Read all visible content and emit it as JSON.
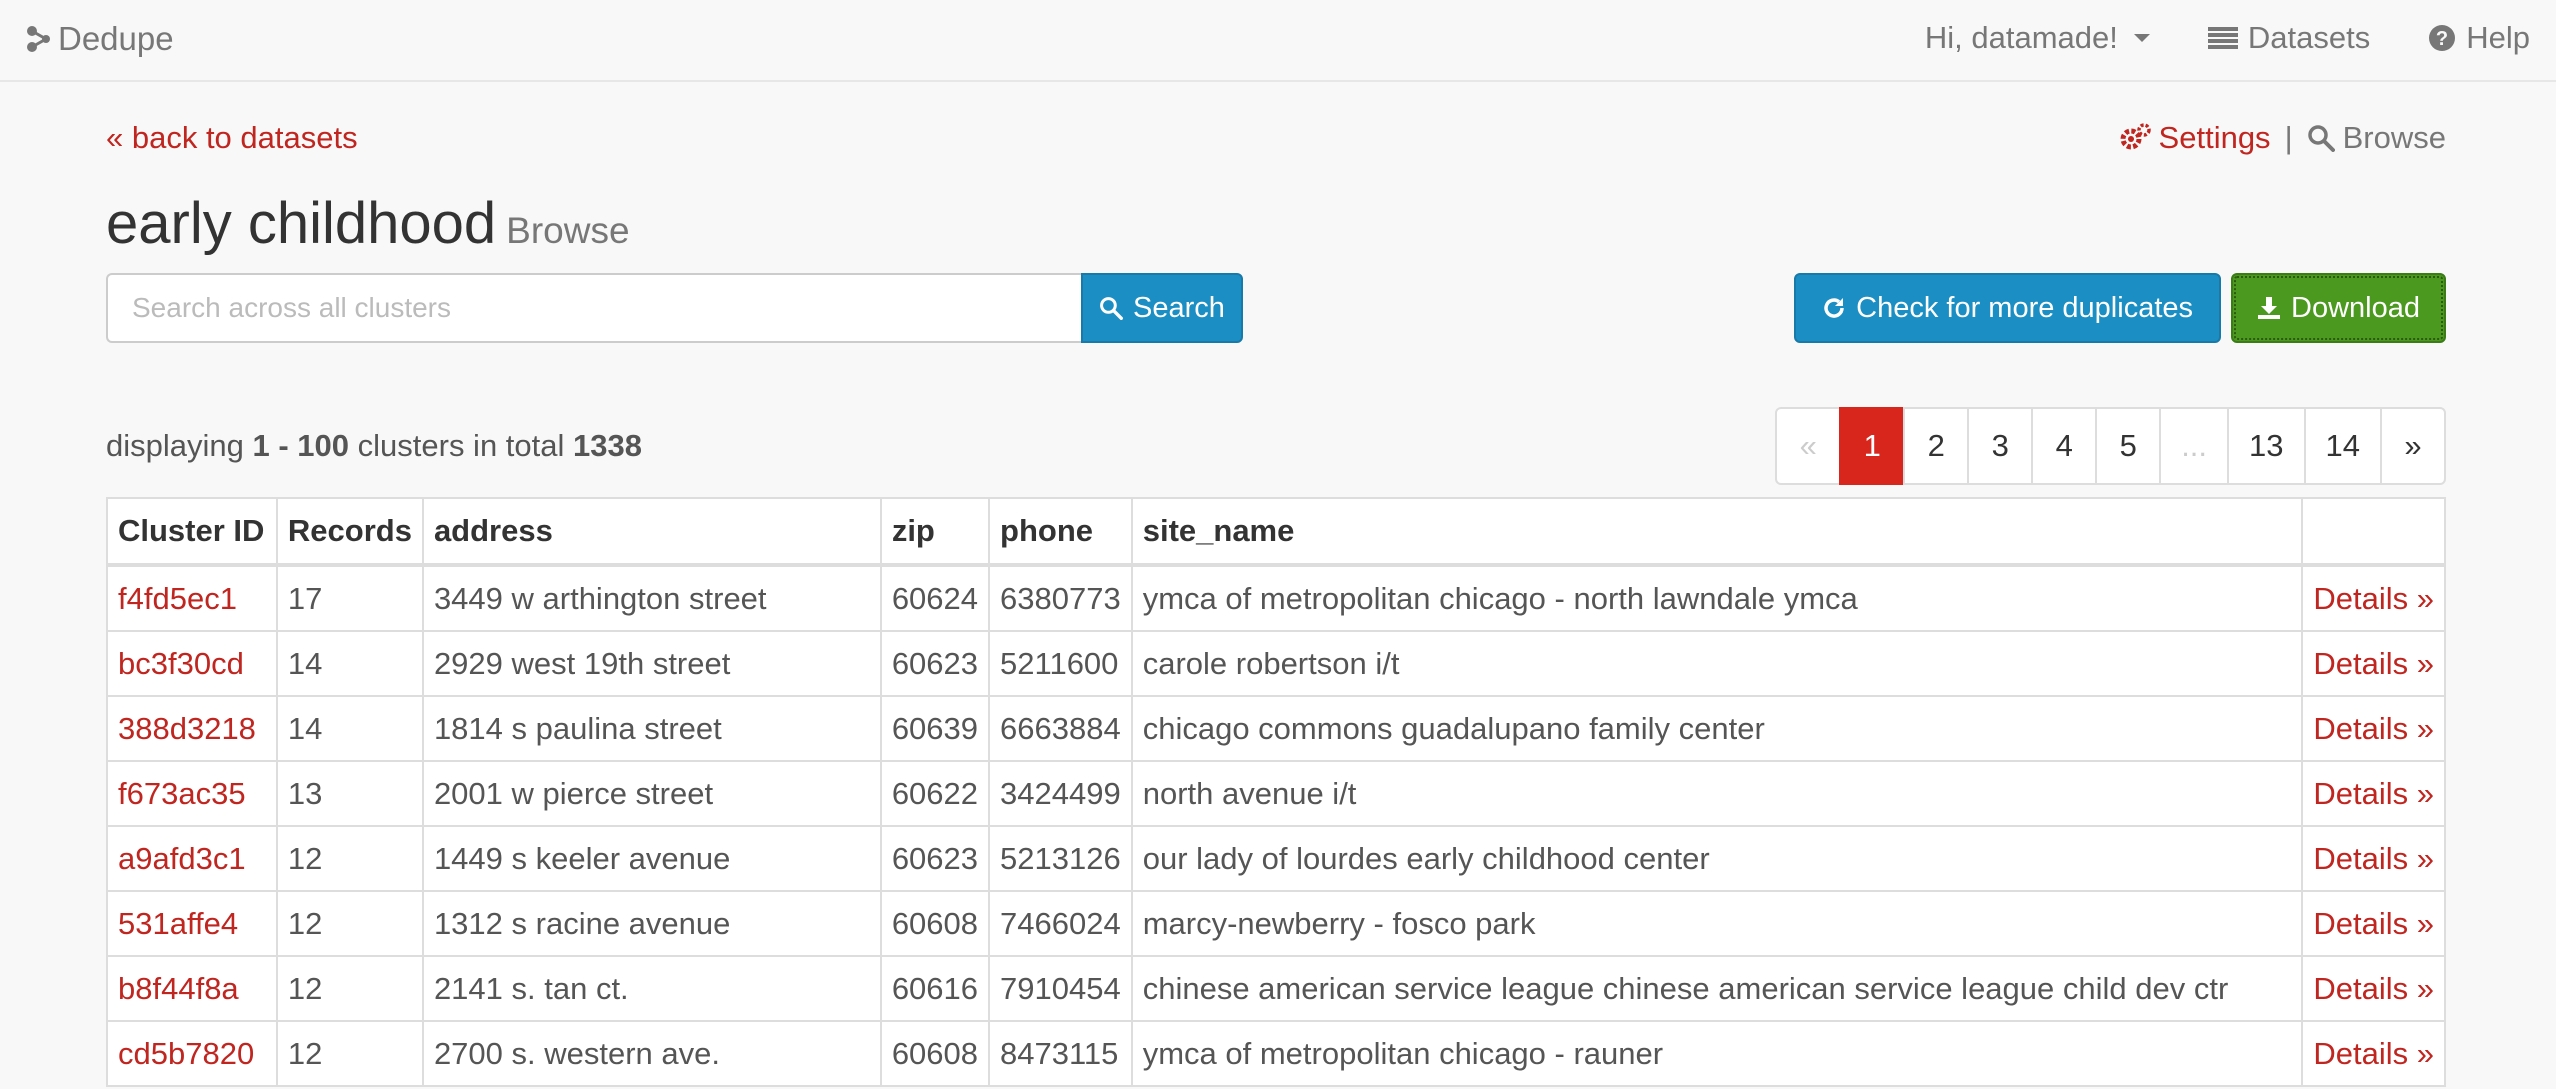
{
  "navbar": {
    "brand": "Dedupe",
    "user_menu": "Hi, datamade!",
    "datasets": "Datasets",
    "help": "Help"
  },
  "page": {
    "back_link": "« back to datasets",
    "settings": "Settings",
    "separator": "|",
    "browse": "Browse",
    "title": "early childhood",
    "subtitle": "Browse"
  },
  "search": {
    "placeholder": "Search across all clusters",
    "button": "Search"
  },
  "actions": {
    "check_duplicates": "Check for more duplicates",
    "download": "Download"
  },
  "summary": {
    "prefix": "displaying",
    "range": "1 - 100",
    "middle": "clusters in total",
    "total": "1338"
  },
  "pagination": [
    "«",
    "1",
    "2",
    "3",
    "4",
    "5",
    "...",
    "13",
    "14",
    "»"
  ],
  "table": {
    "headers": [
      "Cluster ID",
      "Records",
      "address",
      "zip",
      "phone",
      "site_name",
      ""
    ],
    "details_label": "Details »",
    "rows": [
      [
        "f4fd5ec1",
        "17",
        "3449 w arthington street",
        "60624",
        "6380773",
        "ymca of metropolitan chicago - north lawndale ymca"
      ],
      [
        "bc3f30cd",
        "14",
        "2929 west 19th street",
        "60623",
        "5211600",
        "carole robertson i/t"
      ],
      [
        "388d3218",
        "14",
        "1814 s paulina street",
        "60639",
        "6663884",
        "chicago commons guadalupano family center"
      ],
      [
        "f673ac35",
        "13",
        "2001 w pierce street",
        "60622",
        "3424499",
        "north avenue i/t"
      ],
      [
        "a9afd3c1",
        "12",
        "1449 s keeler avenue",
        "60623",
        "5213126",
        "our lady of lourdes early childhood center"
      ],
      [
        "531affe4",
        "12",
        "1312 s racine avenue",
        "60608",
        "7466024",
        "marcy-newberry - fosco park"
      ],
      [
        "b8f44f8a",
        "12",
        "2141 s. tan ct.",
        "60616",
        "7910454",
        "chinese american service league chinese american service league child dev ctr"
      ],
      [
        "cd5b7820",
        "12",
        "2700 s. western ave.",
        "60608",
        "8473115",
        "ymca of metropolitan chicago - rauner"
      ]
    ]
  },
  "icons": {
    "brand": "share-nodes-icon",
    "datasets": "list-icon",
    "help": "question-circle-icon",
    "settings": "gears-icon",
    "browse": "search-icon",
    "refresh": "refresh-icon",
    "download": "download-icon"
  }
}
